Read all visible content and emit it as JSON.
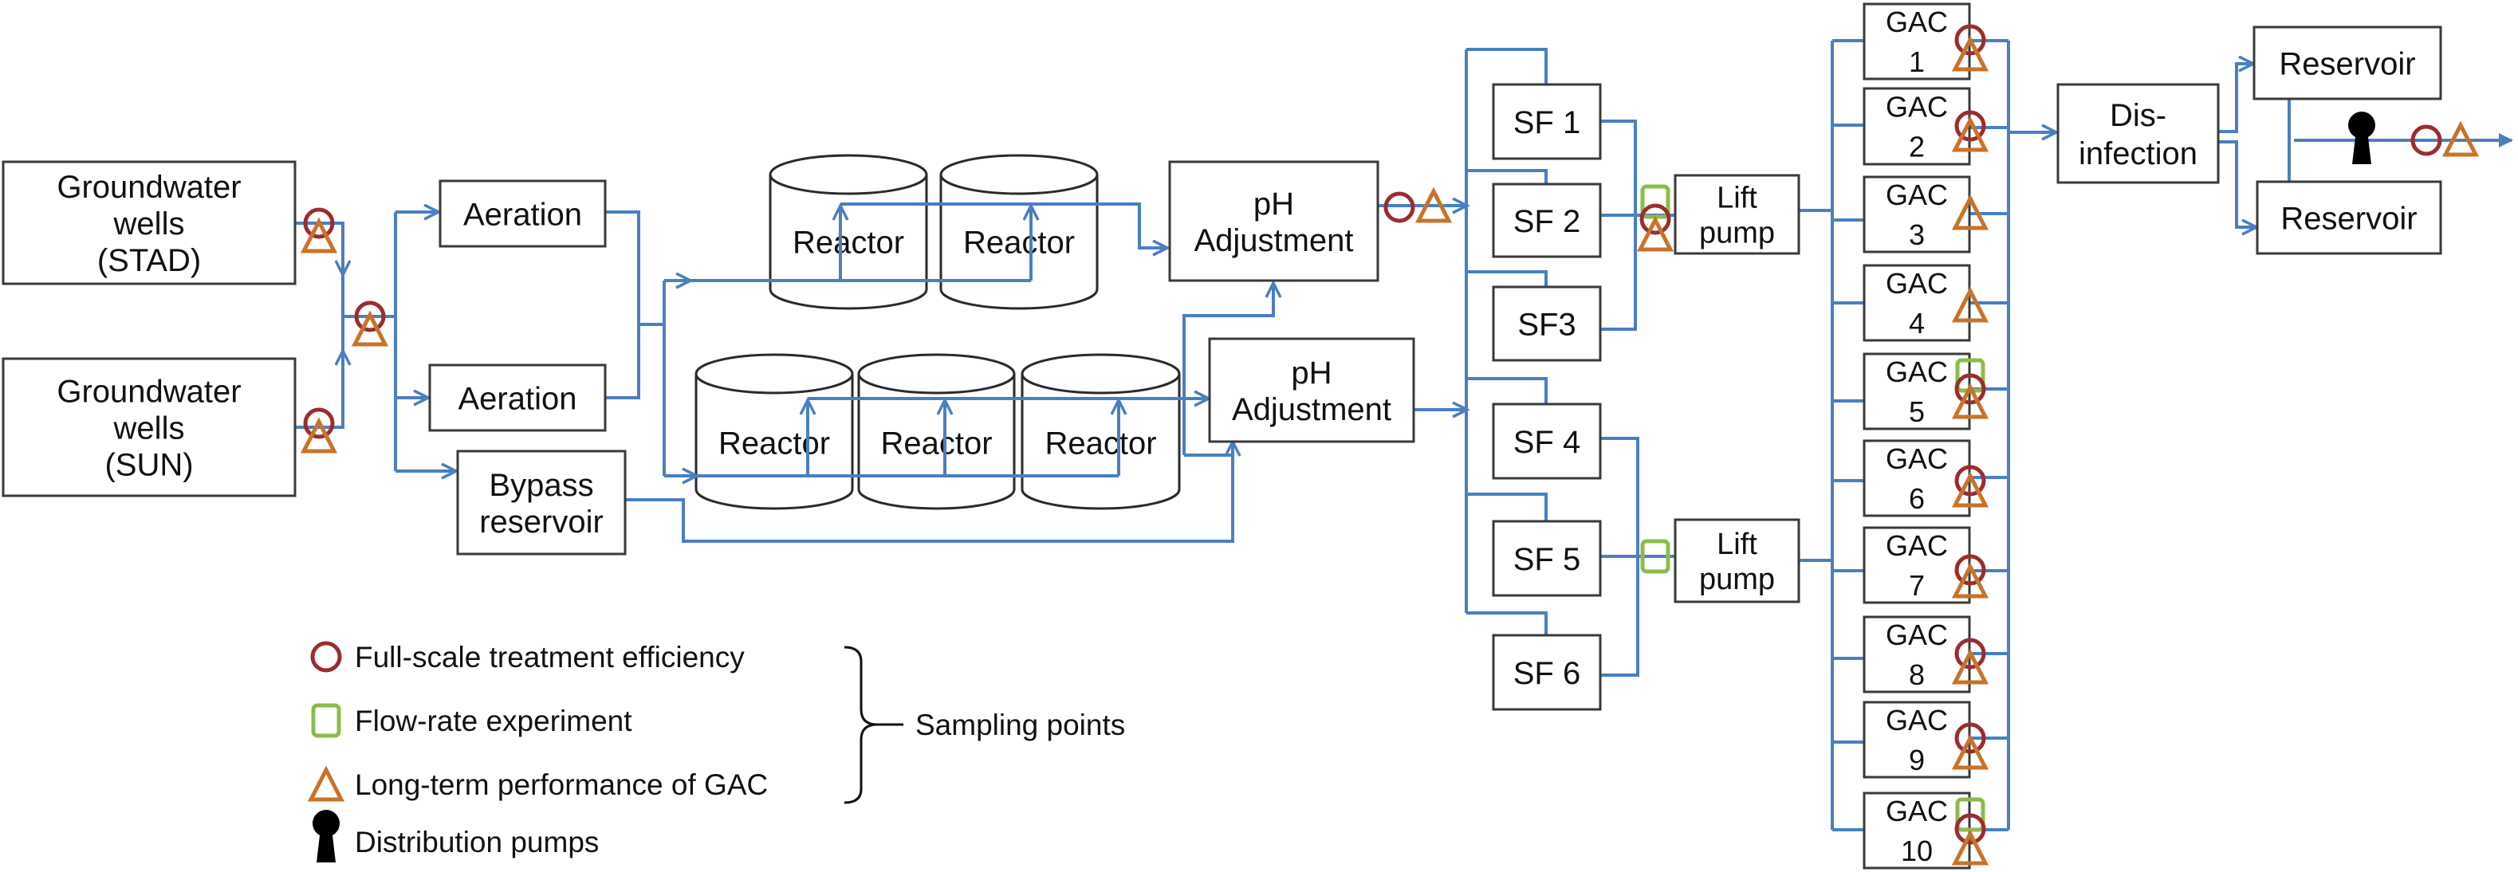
{
  "nodes": {
    "gw_stad": [
      "Groundwater",
      "wells",
      "(STAD)"
    ],
    "gw_sun": [
      "Groundwater",
      "wells",
      "(SUN)"
    ],
    "aeration1": [
      "Aeration"
    ],
    "aeration2": [
      "Aeration"
    ],
    "bypass": [
      "Bypass",
      "reservoir"
    ],
    "reactor": "Reactor",
    "ph1": [
      "pH",
      "Adjustment"
    ],
    "ph2": [
      "pH",
      "Adjustment"
    ],
    "sf": [
      "SF 1",
      "SF 2",
      "SF3",
      "SF 4",
      "SF 5",
      "SF 6"
    ],
    "lift1": [
      "Lift",
      "pump"
    ],
    "lift2": [
      "Lift",
      "pump"
    ],
    "gac": [
      [
        "GAC",
        "1"
      ],
      [
        "GAC",
        "2"
      ],
      [
        "GAC",
        "3"
      ],
      [
        "GAC",
        "4"
      ],
      [
        "GAC",
        "5"
      ],
      [
        "GAC",
        "6"
      ],
      [
        "GAC",
        "7"
      ],
      [
        "GAC",
        "8"
      ],
      [
        "GAC",
        "9"
      ],
      [
        "GAC",
        "10"
      ]
    ],
    "disinfection": [
      "Dis-",
      "infection"
    ],
    "reservoir1": "Reservoir",
    "reservoir2": "Reservoir"
  },
  "sampling_points": {
    "gw_stad_outlet": [
      "circle",
      "triangle"
    ],
    "gw_sun_outlet": [
      "circle",
      "triangle"
    ],
    "combined_raw_water": [
      "circle",
      "triangle"
    ],
    "ph1_outlet": [
      "circle",
      "triangle"
    ],
    "sf_1_3_outlet": [
      "square",
      "circle",
      "triangle"
    ],
    "sf_4_6_outlet": [
      "square"
    ],
    "gac_outlets": [
      [
        "circle",
        "triangle"
      ],
      [
        "circle",
        "triangle"
      ],
      [
        "triangle"
      ],
      [
        "triangle"
      ],
      [
        "square",
        "circle",
        "triangle"
      ],
      [
        "circle",
        "triangle"
      ],
      [
        "circle",
        "triangle"
      ],
      [
        "circle",
        "triangle"
      ],
      [
        "circle",
        "triangle"
      ],
      [
        "square",
        "circle",
        "triangle"
      ]
    ],
    "distribution_outlet": [
      "pump",
      "circle",
      "triangle"
    ]
  },
  "legend": {
    "items": [
      {
        "icon": "circle-icon",
        "label": "Full-scale treatment efficiency"
      },
      {
        "icon": "square-icon",
        "label": "Flow-rate experiment"
      },
      {
        "icon": "triangle-icon",
        "label": "Long-term performance of GAC"
      },
      {
        "icon": "pump-icon",
        "label": "Distribution pumps"
      }
    ],
    "brace_label": "Sampling points"
  },
  "colors": {
    "flow_line": "#4a7fc1",
    "full_scale_circle": "#9b2c2f",
    "flow_rate_square": "#8dbb4b",
    "gac_triangle": "#c8732a",
    "pump": "#000000"
  }
}
